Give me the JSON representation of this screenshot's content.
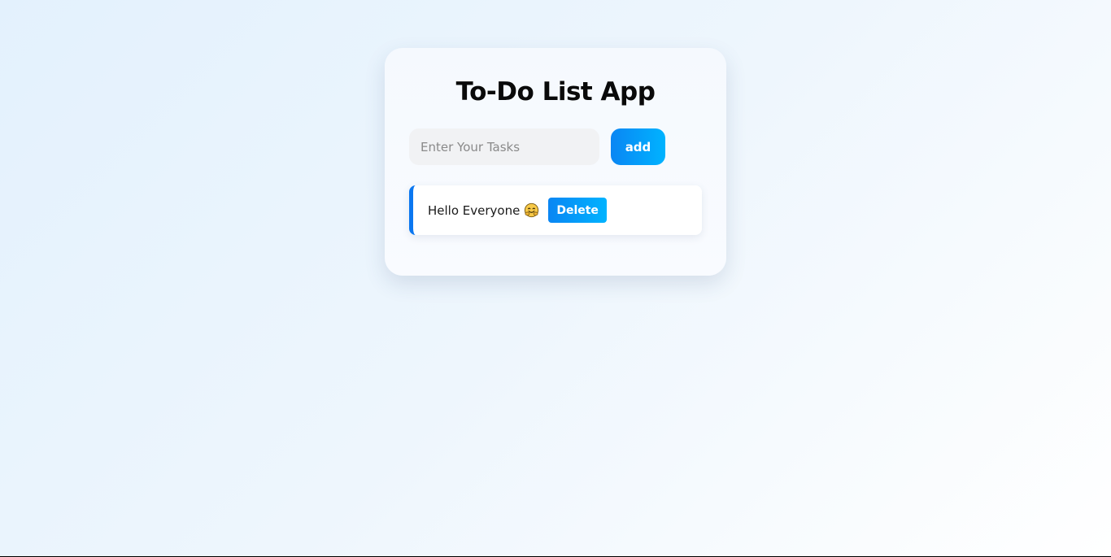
{
  "app": {
    "title": "To-Do List App"
  },
  "form": {
    "input_value": "",
    "input_placeholder": "Enter Your Tasks",
    "add_label": "add"
  },
  "tasks": [
    {
      "text": "Hello Everyone",
      "emoji_icon": "hugging-face-emoji-icon",
      "delete_label": "Delete"
    }
  ],
  "colors": {
    "accent": "#0a86f3",
    "accent_light": "#00b3ff",
    "task_border": "#0b77f0",
    "input_bg": "#f1f2f4"
  }
}
